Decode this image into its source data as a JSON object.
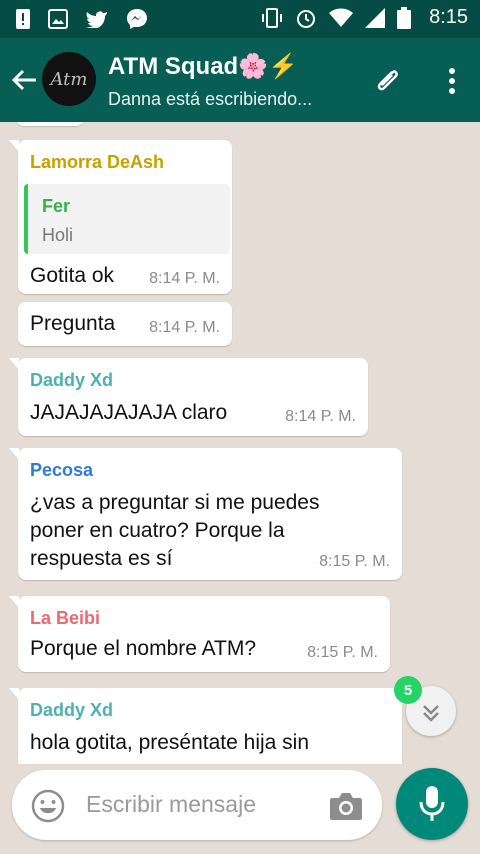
{
  "status_bar": {
    "time": "8:15"
  },
  "header": {
    "avatar_text": "Atm",
    "title": "ATM Squad🌸⚡",
    "subtitle": "Danna está escribiendo..."
  },
  "messages": [
    {
      "sender": "Lamorra DeAsh",
      "sender_color": "#c9a000",
      "quote": {
        "name": "Fer",
        "text": "Holi"
      },
      "text": "Gotita ok",
      "time": "8:14 P. M."
    },
    {
      "sender": "",
      "text": "Pregunta",
      "time": "8:14 P. M."
    },
    {
      "sender": "Daddy Xd",
      "sender_color": "#4fb0b3",
      "text": "JAJAJAJAJAJA claro",
      "time": "8:14 P. M."
    },
    {
      "sender": "Pecosa",
      "sender_color": "#2f7bd6",
      "text_lines": [
        "¿vas a preguntar si me puedes",
        "poner en cuatro? Porque la",
        "respuesta es sí"
      ],
      "time": "8:15 P. M."
    },
    {
      "sender": "La Beibi",
      "sender_color": "#e66b73",
      "text": "Porque el nombre ATM?",
      "time": "8:15 P. M."
    },
    {
      "sender": "Daddy Xd",
      "sender_color": "#4fb0b3",
      "text_lines": [
        "hola gotita, preséntate hija sin"
      ]
    }
  ],
  "scroll_down": {
    "unread_count": "5"
  },
  "composer": {
    "placeholder": "Escribir mensaje"
  },
  "colors": {
    "app_bar": "#075e54",
    "status_bar": "#054d44",
    "chat_bg": "#e5ddd5",
    "fab": "#00897b",
    "badge": "#25d366"
  }
}
